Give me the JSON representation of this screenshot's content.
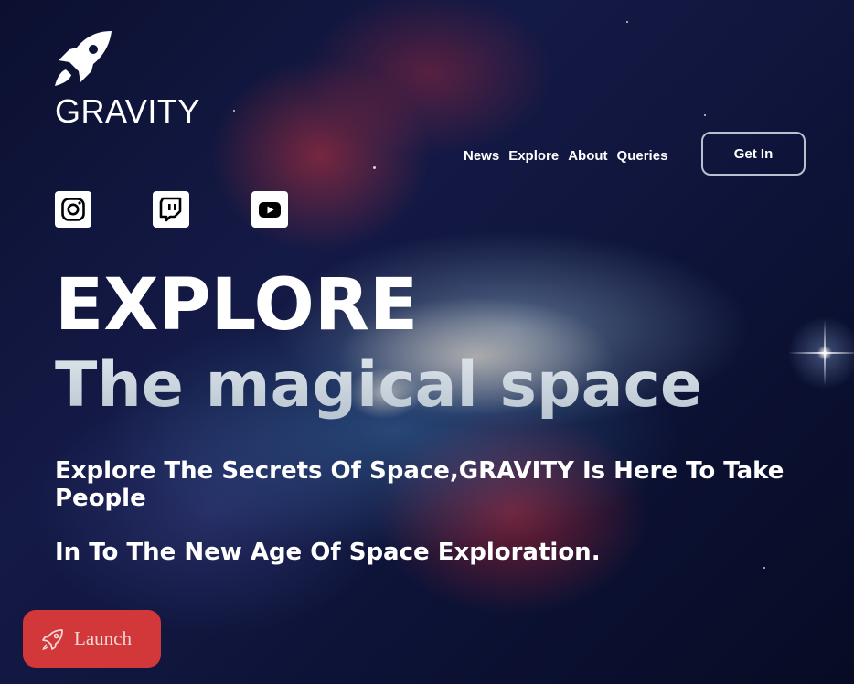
{
  "brand": {
    "logo_icon": "rocket-icon",
    "name": "GRAVITY"
  },
  "nav": {
    "items": [
      "News",
      "Explore",
      "About",
      "Queries"
    ],
    "cta_label": "Get In"
  },
  "social": [
    {
      "icon": "instagram-icon"
    },
    {
      "icon": "twitch-icon"
    },
    {
      "icon": "youtube-icon"
    }
  ],
  "hero": {
    "headline": "EXPLORE",
    "subheadline": "The magical space",
    "tagline_line1": "Explore The Secrets Of Space,GRAVITY Is Here To Take People",
    "tagline_line2": "In To The New Age Of Space Exploration."
  },
  "launch_button": {
    "icon": "rocket-outline-icon",
    "label": "Launch"
  },
  "colors": {
    "background": "#0b1030",
    "launch_button": "#d2373a",
    "cta_border": "#b6c2cf",
    "subheadline": "#c9d3dc"
  }
}
